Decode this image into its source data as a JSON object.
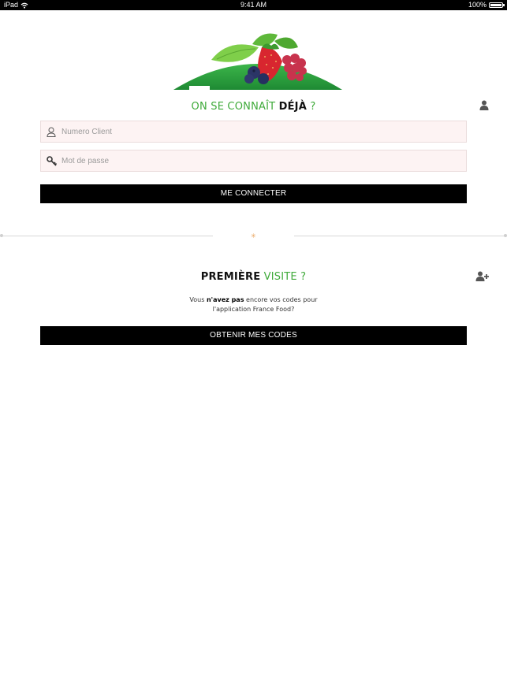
{
  "status_bar": {
    "device": "iPad",
    "time": "9:41 AM",
    "battery": "100%",
    "battery_level": 1.0
  },
  "login": {
    "title_part1": "ON SE CONNAÎT",
    "title_part2": "DÉJÀ",
    "title_part3": "?",
    "client_placeholder": "Numero Client",
    "password_placeholder": "Mot de passe",
    "submit_label": "ME CONNECTER"
  },
  "signup": {
    "title_part1": "PREMIÈRE",
    "title_part2": "VISITE ?",
    "desc_pre": "Vous",
    "desc_bold": "n'avez pas",
    "desc_post": "encore vos codes pour",
    "desc_line2": "l'application France Food?",
    "submit_label": "OBTENIR MES CODES"
  },
  "icons": {
    "user": "user-icon",
    "key": "key-icon",
    "person": "person-icon",
    "add_user": "add-user-icon",
    "wifi": "wifi-icon",
    "battery": "battery-icon"
  },
  "colors": {
    "accent_green": "#3faa3a",
    "button_bg": "#000000",
    "field_bg": "#fdf3f3"
  }
}
